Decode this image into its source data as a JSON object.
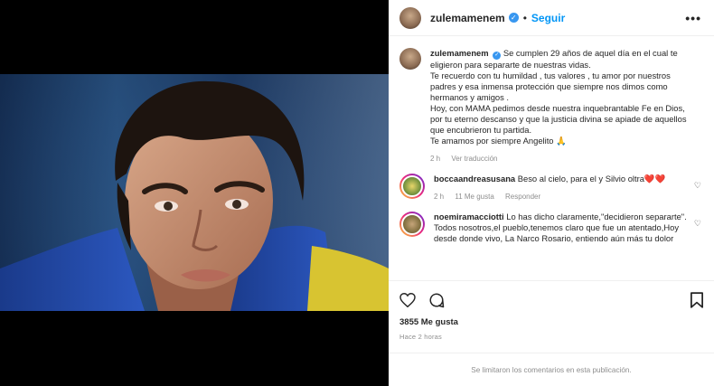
{
  "header": {
    "username": "zulemamenem",
    "separator": "•",
    "follow_label": "Seguir",
    "more": "•••"
  },
  "caption": {
    "username": "zulemamenem",
    "lines": [
      "Se cumplen 29 años de aquel día en el cual te eligieron para separarte de nuestras vidas.",
      "Te recuerdo con tu humildad , tus valores , tu amor por nuestros padres y esa inmensa protección que siempre nos dimos como hermanos y amigos .",
      "Hoy, con MAMA pedimos desde nuestra inquebrantable Fe en Dios, por tu eterno descanso y que la justicia divina se apiade de aquellos que encubrieron tu partida.",
      "Te amamos por siempre Angelito 🙏"
    ],
    "time": "2 h",
    "translate": "Ver traducción"
  },
  "comments": [
    {
      "username": "boccaandreasusana",
      "text": "Beso al cielo, para el y Silvio oltra❤️❤️",
      "time": "2 h",
      "likes": "11 Me gusta",
      "reply": "Responder"
    },
    {
      "username": "noemiramacciotti",
      "text": "Lo has dicho claramente,\"decidieron separarte\". Todos nosotros,el pueblo,tenemos claro que fue un atentado,Hoy desde donde vivo, La Narco Rosario, entiendo aún más tu dolor"
    }
  ],
  "actions": {
    "likes": "3855 Me gusta",
    "time": "Hace 2 horas"
  },
  "footer": {
    "text": "Se limitaron los comentarios en esta publicación."
  },
  "colors": {
    "accent": "#0095f6",
    "verified": "#3897f0",
    "muted": "#8e8e8e",
    "text": "#262626"
  }
}
